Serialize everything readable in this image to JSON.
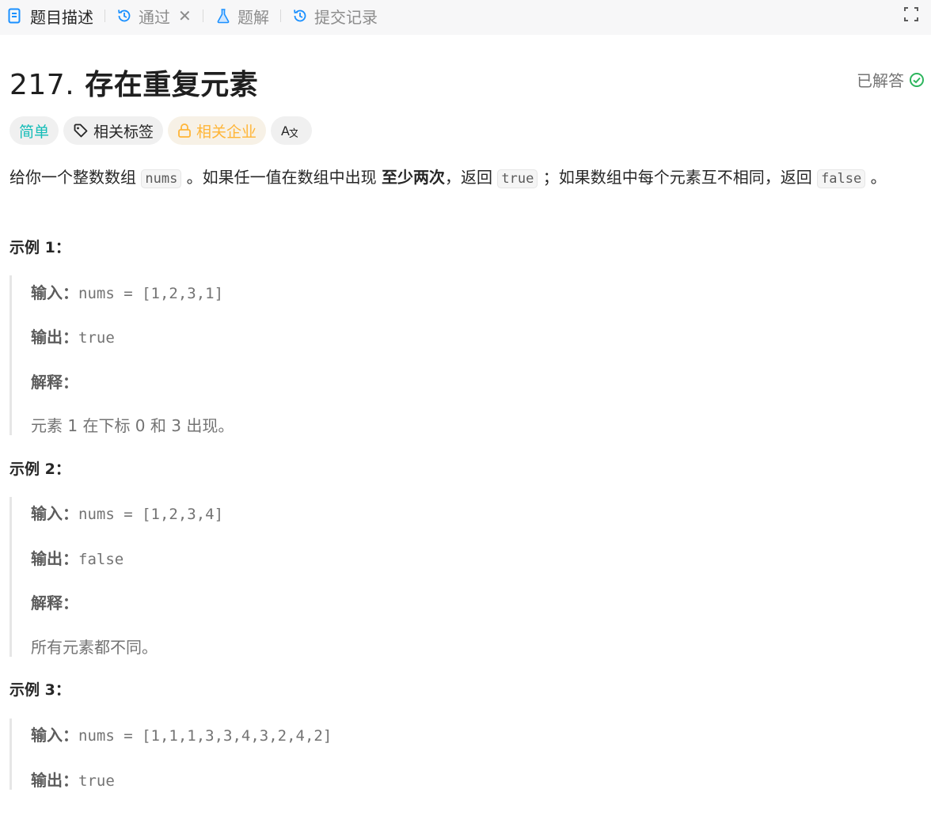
{
  "tabs": {
    "description": "题目描述",
    "passed": "通过",
    "solutions": "题解",
    "submissions": "提交记录"
  },
  "problem": {
    "number": "217.",
    "title": "存在重复元素",
    "status": "已解答"
  },
  "tags": {
    "difficulty": "简单",
    "related_tags": "相关标签",
    "related_companies": "相关企业"
  },
  "description": {
    "p1": "给你一个整数数组",
    "code_nums": "nums",
    "p2": "。如果任一值在数组中出现",
    "bold": "至少两次",
    "p3": "，返回",
    "code_true": "true",
    "p4": "；如果数组中每个元素互不相同，返回",
    "code_false": "false",
    "p5": "。"
  },
  "labels": {
    "input": "输入：",
    "output": "输出：",
    "explanation": "解释："
  },
  "examples": [
    {
      "title": "示例 1：",
      "input": "nums = [1,2,3,1]",
      "output": "true",
      "explanation": "元素 1 在下标 0 和 3 出现。"
    },
    {
      "title": "示例 2：",
      "input": "nums = [1,2,3,4]",
      "output": "false",
      "explanation": "所有元素都不同。"
    },
    {
      "title": "示例 3：",
      "input": "nums = [1,1,1,3,3,4,3,2,4,2]",
      "output": "true"
    }
  ],
  "colors": {
    "accent_blue": "#1a90ff",
    "easy_teal": "#15bdb8",
    "company_amber": "#ffb537",
    "solved_green": "#2db55d"
  }
}
